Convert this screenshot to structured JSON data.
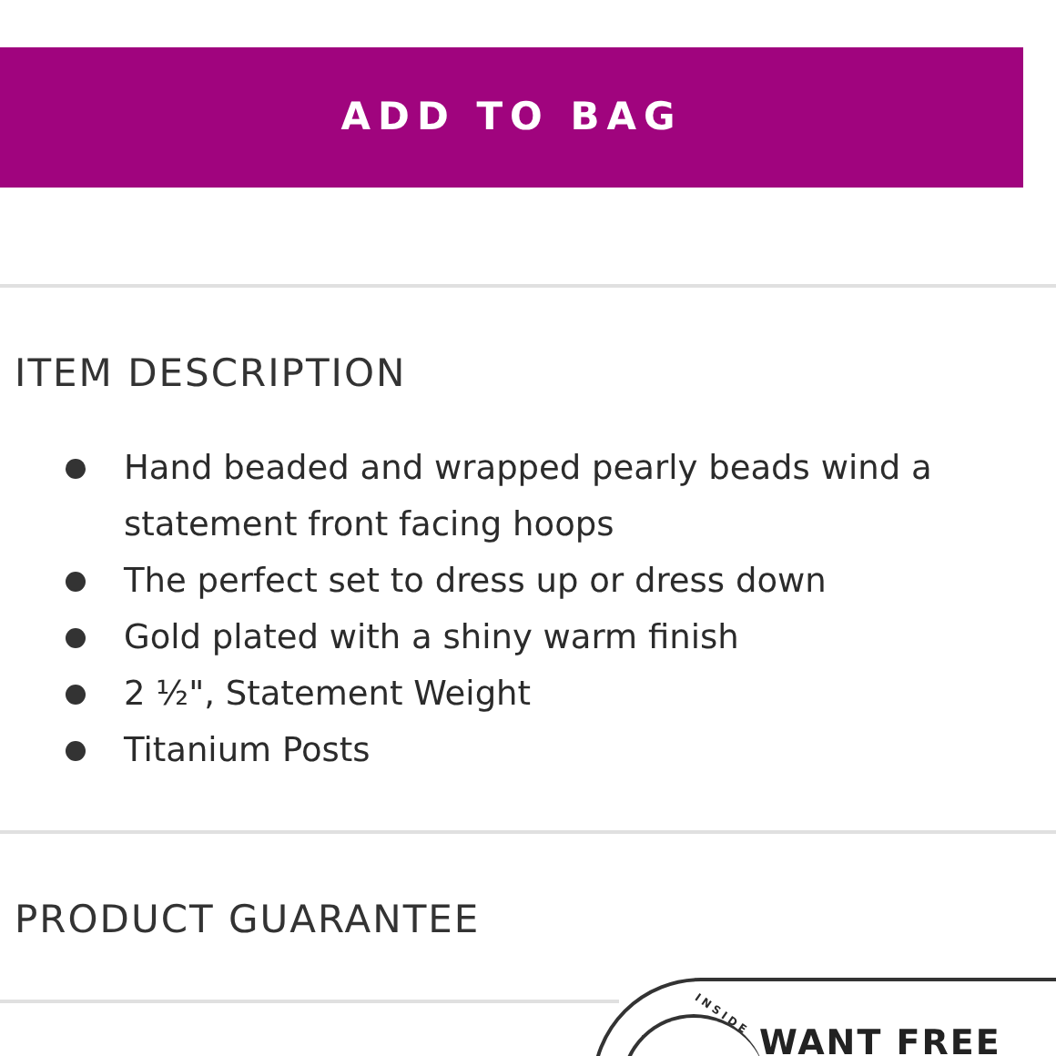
{
  "add_button": {
    "label": "ADD TO BAG"
  },
  "item_description": {
    "heading": "ITEM DESCRIPTION",
    "bullets": [
      {
        "lines": [
          "Hand beaded and wrapped pearly beads wind a",
          "statement front facing hoops"
        ]
      },
      {
        "lines": [
          "The perfect set to dress up or dress down"
        ]
      },
      {
        "lines": [
          "Gold plated with a shiny warm finish"
        ]
      },
      {
        "lines": [
          "2 ½\", Statement Weight"
        ]
      },
      {
        "lines": [
          "Titanium Posts"
        ]
      }
    ]
  },
  "product_guarantee": {
    "heading": "PRODUCT GUARANTEE"
  },
  "promo_badge": {
    "arc_text": "INSIDE",
    "title": "WANT FREE"
  }
}
